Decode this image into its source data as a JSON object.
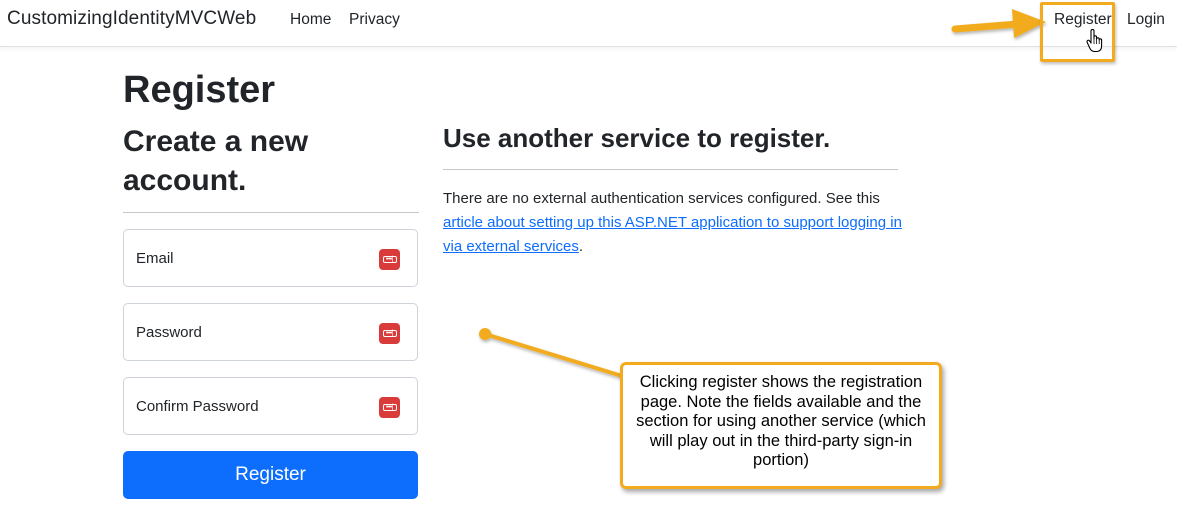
{
  "navbar": {
    "brand": "CustomizingIdentityMVCWeb",
    "links": [
      {
        "label": "Home"
      },
      {
        "label": "Privacy"
      }
    ],
    "register_label": "Register",
    "login_label": "Login"
  },
  "main": {
    "title": "Register",
    "form": {
      "subtitle": "Create a new account.",
      "fields": [
        {
          "label": "Email"
        },
        {
          "label": "Password"
        },
        {
          "label": "Confirm Password"
        }
      ],
      "submit_label": "Register"
    },
    "external": {
      "title": "Use another service to register.",
      "text_before": "There are no external authentication services configured. See this ",
      "link_text": "article about setting up this ASP.NET application to support logging in via external services",
      "text_after": "."
    }
  },
  "annotation": {
    "text": "Clicking register shows the registration page.  Note the fields available and the section for using another service (which will play out in the third-party sign-in portion)",
    "color": "#f2ab1e"
  },
  "colors": {
    "primary": "#0d6efd",
    "password_manager_icon": "#d93b3b",
    "text": "#212529"
  },
  "icons": {
    "password_manager": "password-manager-icon",
    "cursor": "hand-pointer-icon"
  }
}
